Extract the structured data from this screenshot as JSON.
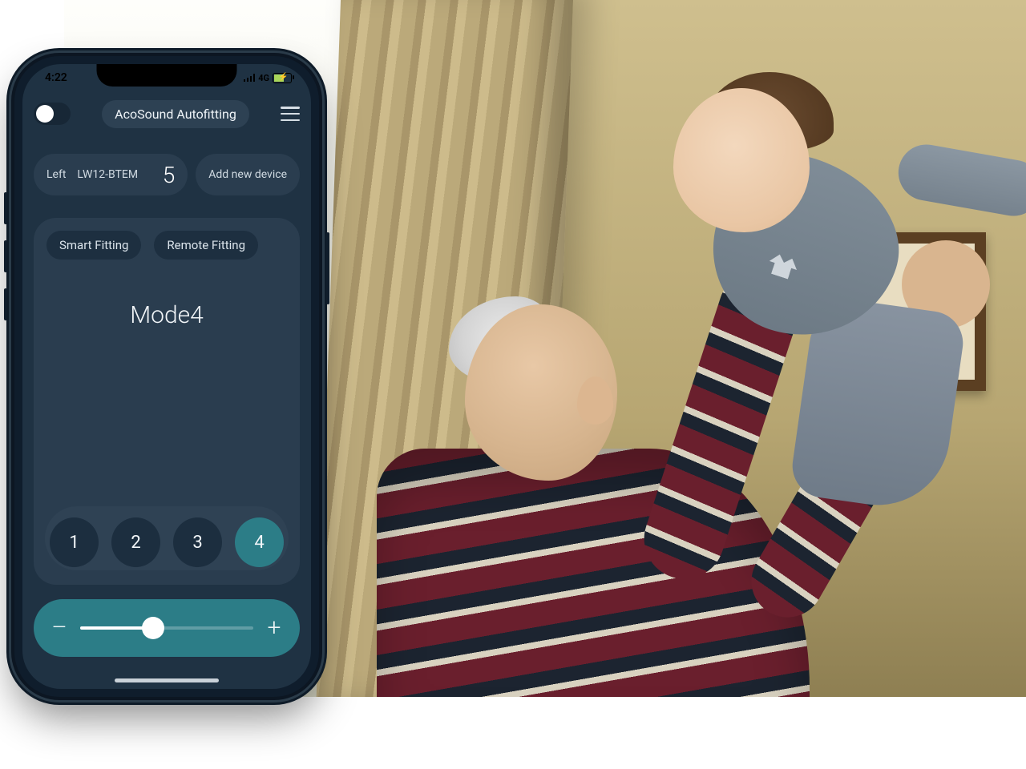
{
  "status_bar": {
    "time": "4:22",
    "network": "4G"
  },
  "header": {
    "title": "AcoSound Autofitting"
  },
  "device": {
    "side_label": "Left",
    "model": "LW12-BTEM",
    "level": "5",
    "add_label": "Add new device"
  },
  "fitting": {
    "tab_smart": "Smart Fitting",
    "tab_remote": "Remote Fitting",
    "mode_label": "Mode4",
    "modes": {
      "m1": "1",
      "m2": "2",
      "m3": "3",
      "m4": "4"
    },
    "active_mode": 4
  },
  "volume": {
    "minus": "–",
    "plus": "+",
    "percent": 42
  },
  "photo": {
    "description": "Illustrative background photo: an older man in a maroon and navy striped sweater lifts a smiling baby in grey clothes overhead, in a warmly lit living room with beige curtains and a window."
  }
}
